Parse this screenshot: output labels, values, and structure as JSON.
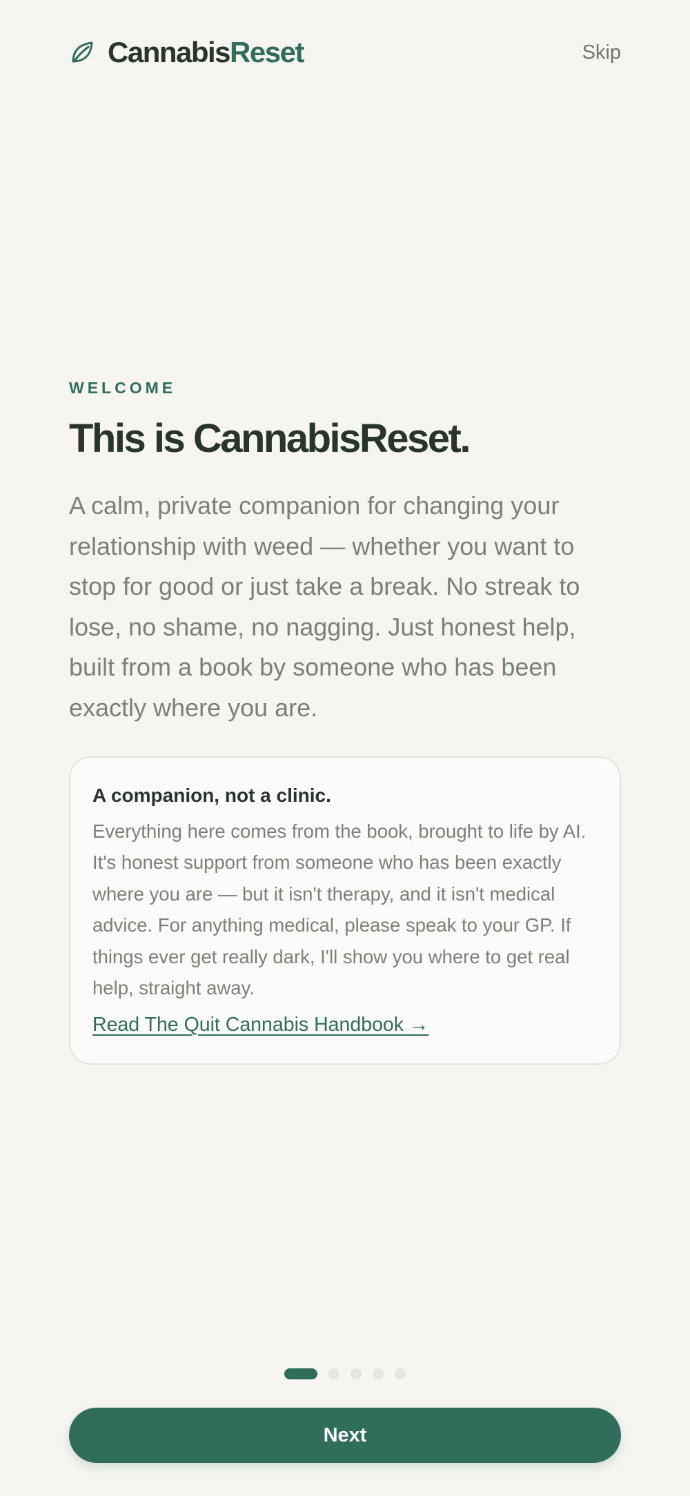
{
  "header": {
    "brand_icon": "leaf-icon",
    "brand_part1": "Cannabis",
    "brand_part2": "Reset",
    "skip_label": "Skip"
  },
  "main": {
    "eyebrow": "WELCOME",
    "title": "This is CannabisReset.",
    "intro": "A calm, private companion for changing your relationship with weed — whether you want to stop for good or just take a break. No streak to lose, no shame, no nagging. Just honest help, built from a book by someone who has been exactly where you are."
  },
  "card": {
    "heading": "A companion, not a clinic.",
    "body": "Everything here comes from the book, brought to life by AI. It's honest support from someone who has been exactly where you are — but it isn't therapy, and it isn't medical advice. For anything medical, please speak to your GP. If things ever get really dark, I'll show you where to get real help, straight away.",
    "link_label": "Read The Quit Cannabis Handbook →"
  },
  "pagination": {
    "total_steps": 5,
    "current_step": 1
  },
  "footer": {
    "next_label": "Next"
  },
  "colors": {
    "accent": "#2e6e5b",
    "background": "#f6f5f1",
    "heading": "#28352e",
    "body_text": "#7a807a"
  }
}
